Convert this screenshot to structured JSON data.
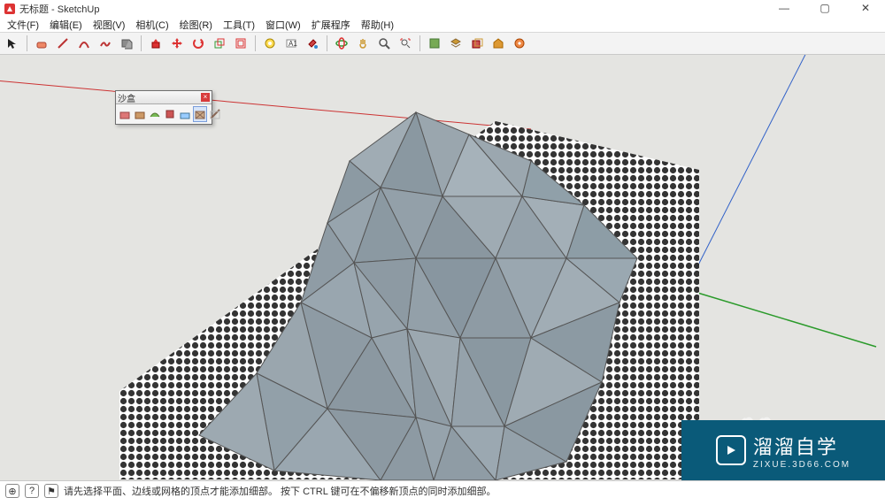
{
  "window": {
    "title": "无标题 - SketchUp",
    "min": "—",
    "max": "▢",
    "close": "✕"
  },
  "menu": {
    "file": "文件(F)",
    "edit": "编辑(E)",
    "view": "视图(V)",
    "camera": "相机(C)",
    "draw": "绘图(R)",
    "tools": "工具(T)",
    "window": "窗口(W)",
    "ext": "扩展程序",
    "help": "帮助(H)"
  },
  "palette": {
    "title": "沙盒",
    "close": "×"
  },
  "statusbar": {
    "hint": "请先选择平面、边线或网格的顶点才能添加细部。 按下 CTRL 键可在不偏移新顶点的同时添加细部。",
    "icon1": "⊕",
    "icon2": "?",
    "icon3": "⚑"
  },
  "watermark": {
    "brand": "溜溜自学",
    "url": "ZIXUE.3D66.COM"
  },
  "icons": {
    "cursor": "↖",
    "app": "S"
  }
}
